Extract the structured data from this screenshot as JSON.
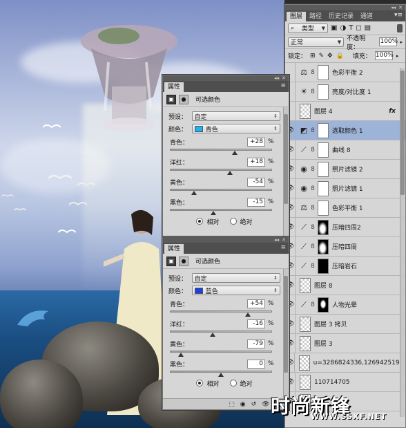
{
  "watermark": {
    "text": "时尚新锋",
    "sub": "WWW.SSXF.NET"
  },
  "props_top": {
    "tab": "属性",
    "header_label": "可选颜色",
    "preset_label": "预设：",
    "preset_value": "自定",
    "color_label": "颜色：",
    "color_value": "青色",
    "color_swatch": "#1fb2f0",
    "sliders": [
      {
        "label": "青色：",
        "value": "+28",
        "unit": "%",
        "pct": 64
      },
      {
        "label": "洋红：",
        "value": "+18",
        "unit": "%",
        "pct": 59
      },
      {
        "label": "黄色：",
        "value": "-54",
        "unit": "%",
        "pct": 23
      },
      {
        "label": "黑色：",
        "value": "-15",
        "unit": "%",
        "pct": 42.5
      }
    ],
    "radio_relative": "相对",
    "radio_absolute": "绝对"
  },
  "props_bottom": {
    "tab": "属性",
    "header_label": "可选颜色",
    "preset_label": "预设：",
    "preset_value": "自定",
    "color_label": "颜色：",
    "color_value": "蓝色",
    "color_swatch": "#1d3fe0",
    "sliders": [
      {
        "label": "青色：",
        "value": "+54",
        "unit": "%",
        "pct": 77
      },
      {
        "label": "洋红：",
        "value": "-16",
        "unit": "%",
        "pct": 42
      },
      {
        "label": "黄色：",
        "value": "-79",
        "unit": "%",
        "pct": 10.5
      },
      {
        "label": "黑色：",
        "value": "0",
        "unit": "%",
        "pct": 50
      }
    ],
    "radio_relative": "相对",
    "radio_absolute": "绝对"
  },
  "layers": {
    "tabs": [
      "图层",
      "路径",
      "历史记录",
      "通道"
    ],
    "kind_label": "类型",
    "blend_mode": "正常",
    "opacity_label": "不透明度：",
    "opacity_value": "100%",
    "lock_label": "锁定：",
    "fill_label": "填充：",
    "fill_value": "100%",
    "items": [
      {
        "name": "色彩平衡 2",
        "visible": false,
        "adj": "⚖",
        "mask": "white"
      },
      {
        "name": "亮度/对比度 1",
        "visible": false,
        "adj": "☀",
        "mask": "white"
      },
      {
        "name": "图层 4",
        "visible": false,
        "adj": "",
        "mask": "checker",
        "fx": "fx"
      },
      {
        "name": "选取颜色 1",
        "visible": true,
        "adj": "◩",
        "mask": "white",
        "selected": true
      },
      {
        "name": "曲线 8",
        "visible": true,
        "adj": "⟋",
        "mask": "white"
      },
      {
        "name": "照片滤镜 2",
        "visible": true,
        "adj": "◉",
        "mask": "white"
      },
      {
        "name": "照片滤镜 1",
        "visible": true,
        "adj": "◉",
        "mask": "white"
      },
      {
        "name": "色彩平衡 1",
        "visible": true,
        "adj": "⚖",
        "mask": "white"
      },
      {
        "name": "压暗四周2",
        "visible": true,
        "adj": "⟋",
        "mask": "darkedge"
      },
      {
        "name": "压暗四周",
        "visible": true,
        "adj": "⟋",
        "mask": "darkedge"
      },
      {
        "name": "压暗岩石",
        "visible": true,
        "adj": "⟋",
        "mask": "black"
      },
      {
        "name": "图层 8",
        "visible": true,
        "adj": "",
        "mask": "checker"
      },
      {
        "name": "人物光晕",
        "visible": true,
        "adj": "⟋",
        "mask": "figure"
      },
      {
        "name": "图层 3 拷贝",
        "visible": true,
        "adj": "",
        "mask": "checker"
      },
      {
        "name": "图层 3",
        "visible": true,
        "adj": "",
        "mask": "checker"
      },
      {
        "name": "u=3286824336,1269425191...",
        "visible": true,
        "adj": "",
        "mask": "checker"
      },
      {
        "name": "110714705",
        "visible": true,
        "adj": "",
        "mask": "checker"
      },
      {
        "name": "",
        "visible": true,
        "adj": "",
        "mask": "checker"
      }
    ]
  }
}
